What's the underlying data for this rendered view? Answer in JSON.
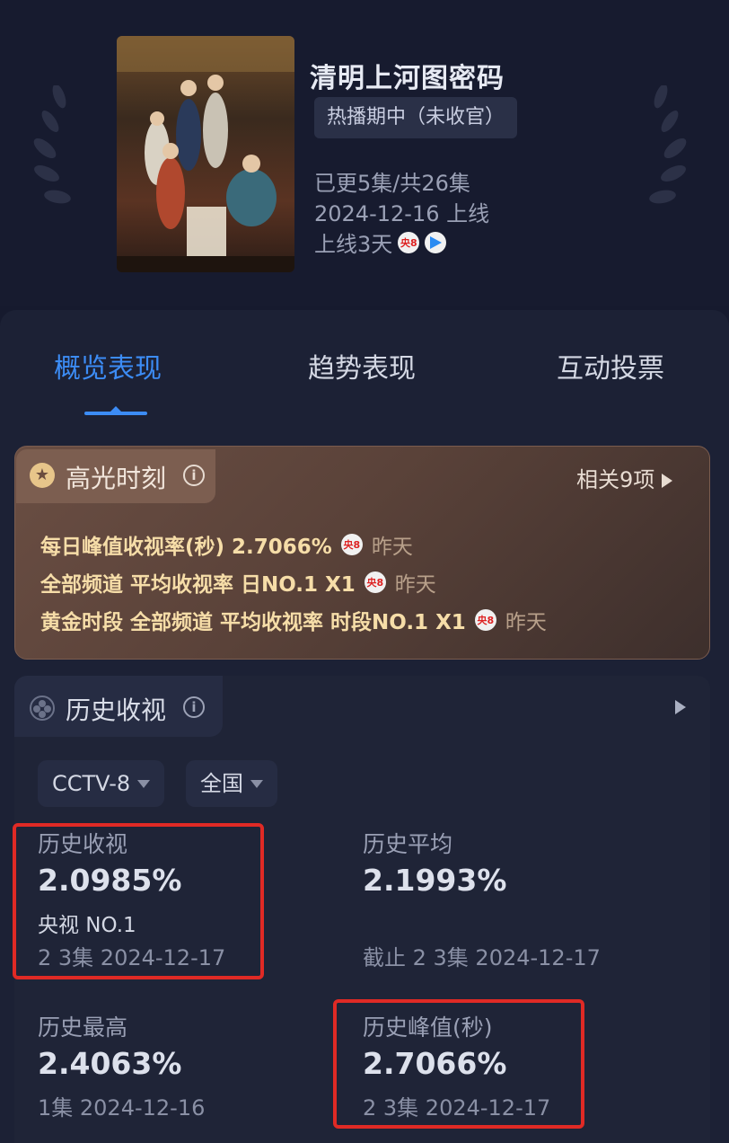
{
  "show": {
    "title": "清明上河图密码",
    "status": "热播期中（未收官）",
    "episodes": "已更5集/共26集",
    "premiere": "2024-12-16 上线",
    "days_online": "上线3天",
    "channel_badge": "央8"
  },
  "tabs": [
    "概览表现",
    "趋势表现",
    "互动投票"
  ],
  "highlight": {
    "title": "高光时刻",
    "related": "相关9项",
    "rows": [
      {
        "text": "每日峰值收视率(秒)  2.7066%",
        "badge": "央8",
        "when": "昨天"
      },
      {
        "text": "全部频道 平均收视率  日NO.1 X1",
        "badge": "央8",
        "when": "昨天"
      },
      {
        "text": "黄金时段 全部频道 平均收视率  时段NO.1 X1",
        "badge": "央8",
        "when": "昨天"
      }
    ]
  },
  "history": {
    "title": "历史收视",
    "filters": {
      "channel": "CCTV-8",
      "region": "全国"
    },
    "stats": {
      "rating": {
        "label": "历史收视",
        "value": "2.0985%",
        "rank": "央视 NO.1",
        "date": "2 3集 2024-12-17"
      },
      "average": {
        "label": "历史平均",
        "value": "2.1993%",
        "date": "截止 2 3集 2024-12-17"
      },
      "highest": {
        "label": "历史最高",
        "value": "2.4063%",
        "date": "1集 2024-12-16"
      },
      "peak": {
        "label": "历史峰值(秒)",
        "value": "2.7066%",
        "date": "2 3集 2024-12-17"
      }
    }
  },
  "colors": {
    "accent": "#3c8cf5",
    "highlight_text": "#f6dda8",
    "annotation": "#e02a25"
  }
}
